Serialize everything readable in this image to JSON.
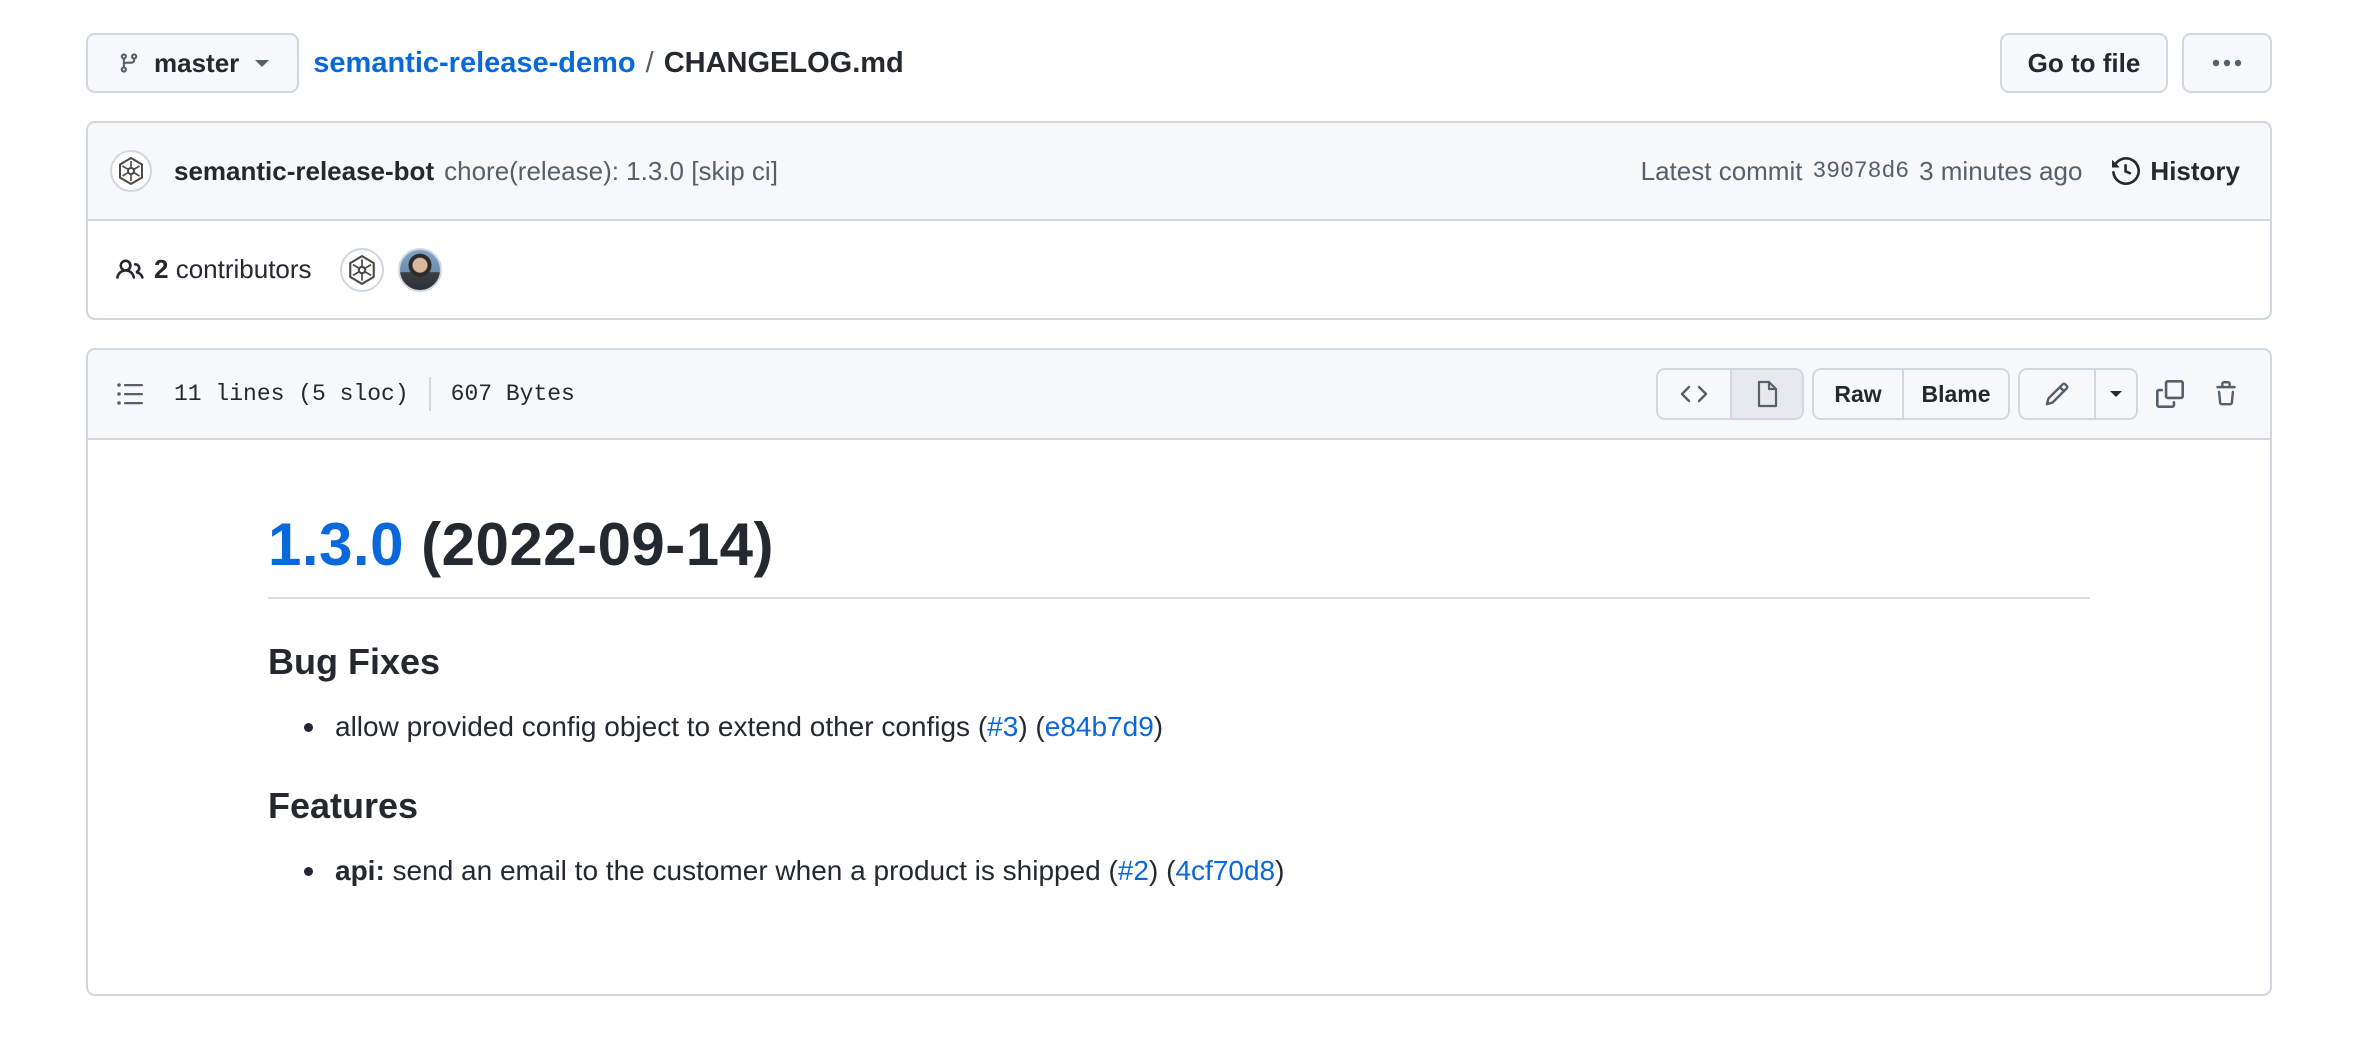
{
  "header": {
    "branch": "master",
    "repo": "semantic-release-demo",
    "separator": "/",
    "file": "CHANGELOG.md",
    "goto_file": "Go to file",
    "more": "···"
  },
  "commit": {
    "author": "semantic-release-bot",
    "message": "chore(release): 1.3.0 [skip ci]",
    "latest_label": "Latest commit",
    "sha": "39078d6",
    "time": "3 minutes ago",
    "history": "History"
  },
  "contributors": {
    "count": "2",
    "label": "contributors"
  },
  "file_header": {
    "lines": "11 lines (5 sloc)",
    "size": "607 Bytes",
    "raw": "Raw",
    "blame": "Blame"
  },
  "markdown": {
    "h1_version": "1.3.0",
    "h1_date": "(2022-09-14)",
    "sections": [
      {
        "title": "Bug Fixes",
        "item": {
          "prefix": "",
          "text": "allow provided config object to extend other configs (",
          "issue": "#3",
          "mid": ") (",
          "commit": "e84b7d9",
          "end": ")"
        }
      },
      {
        "title": "Features",
        "item": {
          "prefix": "api:",
          "text": " send an email to the customer when a product is shipped (",
          "issue": "#2",
          "mid": ") (",
          "commit": "4cf70d8",
          "end": ")"
        }
      }
    ]
  }
}
